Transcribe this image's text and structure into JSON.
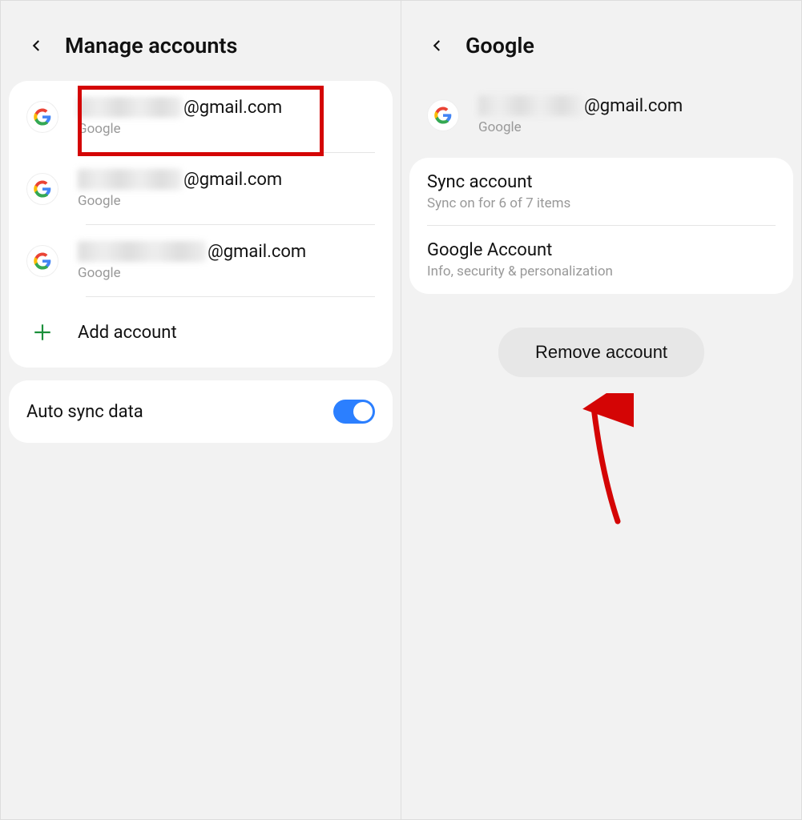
{
  "left": {
    "title": "Manage accounts",
    "accounts": [
      {
        "email_suffix": "@gmail.com",
        "provider": "Google"
      },
      {
        "email_suffix": "@gmail.com",
        "provider": "Google"
      },
      {
        "email_suffix": "@gmail.com",
        "provider": "Google"
      }
    ],
    "add_label": "Add account",
    "auto_sync": {
      "label": "Auto sync data",
      "enabled": true
    }
  },
  "right": {
    "title": "Google",
    "account": {
      "email_suffix": "@gmail.com",
      "provider": "Google"
    },
    "settings": [
      {
        "title": "Sync account",
        "sub": "Sync on for 6 of 7 items"
      },
      {
        "title": "Google Account",
        "sub": "Info, security & personalization"
      }
    ],
    "remove_label": "Remove account"
  }
}
